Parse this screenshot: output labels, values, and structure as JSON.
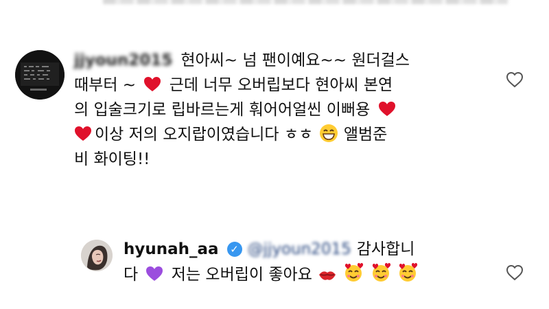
{
  "comments": [
    {
      "username": "jjyoun2015",
      "text_line_1": "현아씨~ 넘 팬이예요~~ 원더걸스",
      "text_line_2a": "때부터 ~",
      "text_line_2b": "근데 너무 오버립보다 현아씨 본연",
      "text_line_3a": "의 입술크기로 립바르는게 훠어어얼씬 이뻐용",
      "text_line_4": "이상 저의 오지랍이였습니다 ㅎㅎ",
      "text_line_4b": "앨범준",
      "text_line_5": "비 화이팅!!"
    },
    {
      "username": "hyunah_aa",
      "mention": "@jjyoun2015",
      "text_line_1": "감사합니",
      "text_line_2a": "다",
      "text_line_2b": "저는 오버립이 좋아요"
    }
  ],
  "icons": {
    "heart": "heart-icon",
    "purple_heart": "purple-heart-icon",
    "grinning": "grinning-face-icon",
    "kiss": "kiss-lips-icon",
    "smiling_hearts": "smiling-face-with-hearts-icon",
    "like": "like-icon",
    "verified": "verified-badge-icon"
  },
  "colors": {
    "text": "#111111",
    "heart": "#e0112b",
    "purple_heart": "#9b4dde",
    "verified": "#3897f0"
  }
}
